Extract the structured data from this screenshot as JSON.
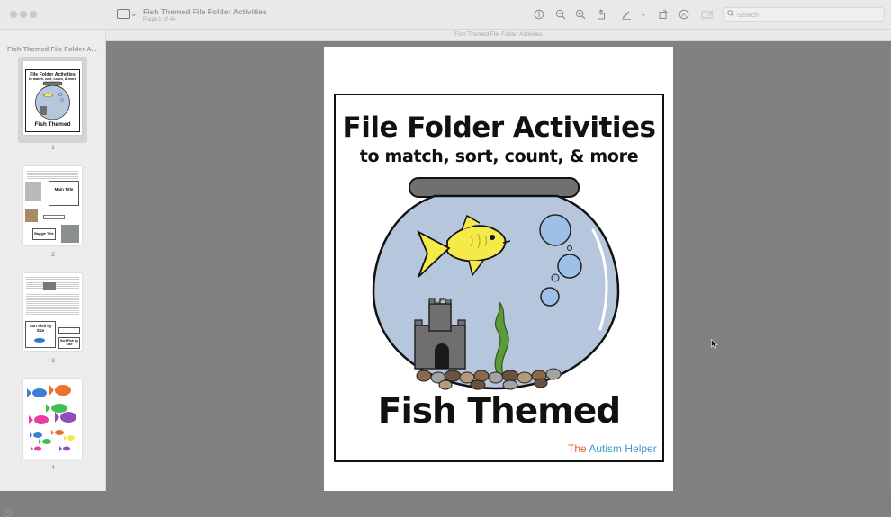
{
  "window": {
    "doc_title": "Fish Themed File Folder Activities",
    "page_info": "Page 1 of 44",
    "page_bar_label": "Fish Themed File Folder Activities"
  },
  "toolbar": {
    "search_placeholder": "Search",
    "icons": [
      "info-icon",
      "zoom-out-icon",
      "zoom-in-icon",
      "share-icon",
      "markup-pen-icon",
      "rotate-icon",
      "annotate-icon",
      "form-fill-icon",
      "search-icon"
    ]
  },
  "sidebar": {
    "title": "Fish Themed File Folder A...",
    "pages": [
      {
        "number": "1",
        "selected": true
      },
      {
        "number": "2",
        "selected": false
      },
      {
        "number": "3",
        "selected": false
      },
      {
        "number": "4",
        "selected": false
      }
    ],
    "thumb1": {
      "title": "File Folder Activities",
      "subtitle": "to match, sort, count, & more",
      "footer": "Fish Themed"
    },
    "thumb2": {
      "label1": "Main Title",
      "label2": "Baggie Title"
    },
    "thumb3": {
      "label1": "Sort Fish by Size",
      "label2": "Sort Fish by Size"
    }
  },
  "document": {
    "title": "File Folder Activities",
    "subtitle": "to match, sort, count, & more",
    "footer_title": "Fish Themed",
    "brand_the": "The ",
    "brand_autism": "Autism ",
    "brand_helper": "Helper"
  },
  "colors": {
    "water": "#b6c7dd",
    "fish": "#f4ea4a",
    "bowl_rim": "#707070",
    "castle": "#6f6f6f",
    "bubble": "#9ec0e8"
  }
}
